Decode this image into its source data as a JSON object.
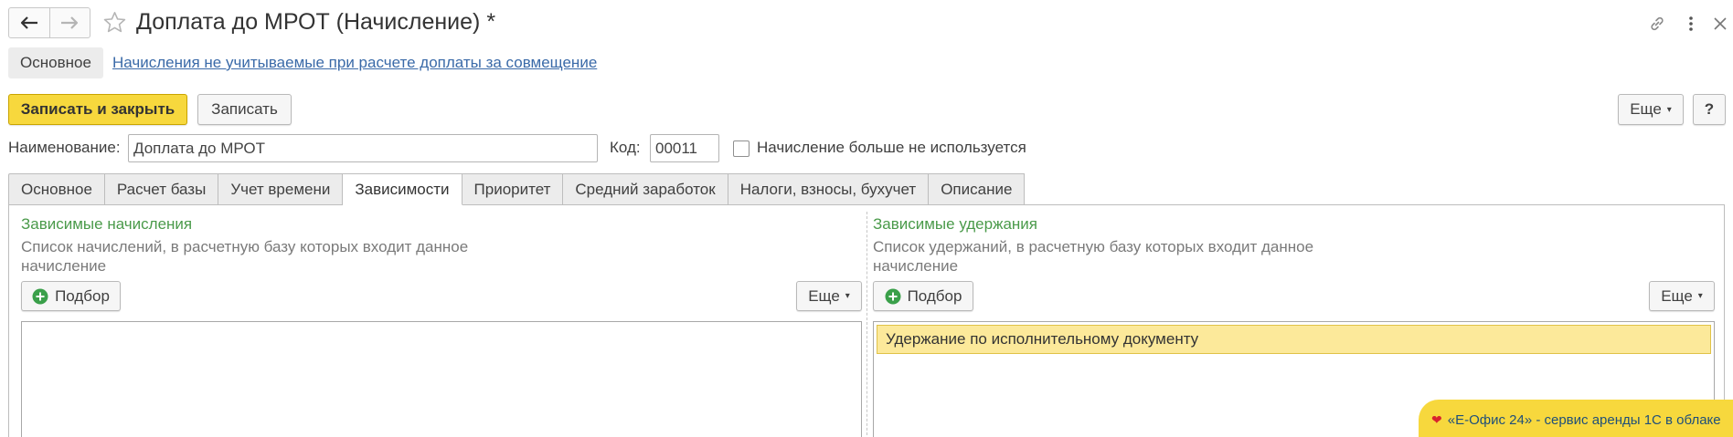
{
  "window": {
    "title": "Доплата до МРОТ (Начисление) *",
    "back_icon": "arrow-left-icon",
    "forward_icon": "arrow-right-icon",
    "favorite_icon": "star-icon",
    "link_icon": "link-icon",
    "more_icon": "more-vertical-icon",
    "close_icon": "close-icon"
  },
  "sections": {
    "main_label": "Основное",
    "link_label": "Начисления не учитываемые при расчете доплаты за совмещение"
  },
  "toolbar": {
    "save_close_label": "Записать и закрыть",
    "save_label": "Записать",
    "more_label": "Еще",
    "help_label": "?"
  },
  "form": {
    "name_label": "Наименование:",
    "name_value": "Доплата до МРОТ",
    "code_label": "Код:",
    "code_value": "00011",
    "unused_label": "Начисление больше не используется",
    "unused_checked": false
  },
  "tabs": [
    {
      "label": "Основное",
      "active": false
    },
    {
      "label": "Расчет базы",
      "active": false
    },
    {
      "label": "Учет времени",
      "active": false
    },
    {
      "label": "Зависимости",
      "active": true
    },
    {
      "label": "Приоритет",
      "active": false
    },
    {
      "label": "Средний заработок",
      "active": false
    },
    {
      "label": "Налоги, взносы, бухучет",
      "active": false
    },
    {
      "label": "Описание",
      "active": false
    }
  ],
  "dependent_accruals": {
    "title": "Зависимые начисления",
    "description": "Список начислений, в расчетную базу которых входит данное начисление",
    "pick_label": "Подбор",
    "more_label": "Еще",
    "items": []
  },
  "dependent_deductions": {
    "title": "Зависимые удержания",
    "description": "Список удержаний, в расчетную базу которых входит данное начисление",
    "pick_label": "Подбор",
    "more_label": "Еще",
    "items": [
      "Удержание по исполнительному документу"
    ]
  },
  "promo": {
    "text": "«Е-Офис 24» - сервис аренды 1С в облаке"
  },
  "colors": {
    "primary_button": "#f7d83d",
    "group_title": "#4a9a4a",
    "link": "#3a6aa8",
    "selected_row": "#fce99a",
    "promo_text": "#1f4f7a"
  }
}
